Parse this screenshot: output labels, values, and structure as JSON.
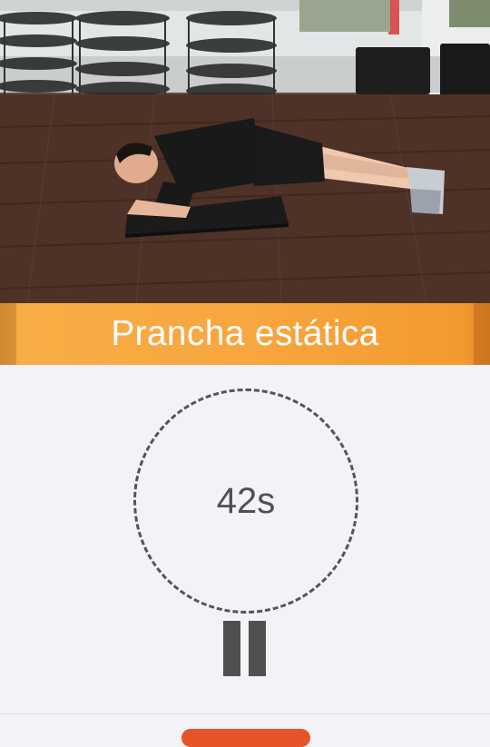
{
  "exercise": {
    "name": "Prancha estática",
    "image_alt": "Homem fazendo prancha sobre um colchonete"
  },
  "timer": {
    "remaining": "42s"
  },
  "controls": {
    "pause_icon": "pause-icon",
    "bottom_button_color": "#e8542a"
  },
  "colors": {
    "accent": "#f8a640",
    "background": "#f3f3f7",
    "timer_text": "#505050"
  }
}
